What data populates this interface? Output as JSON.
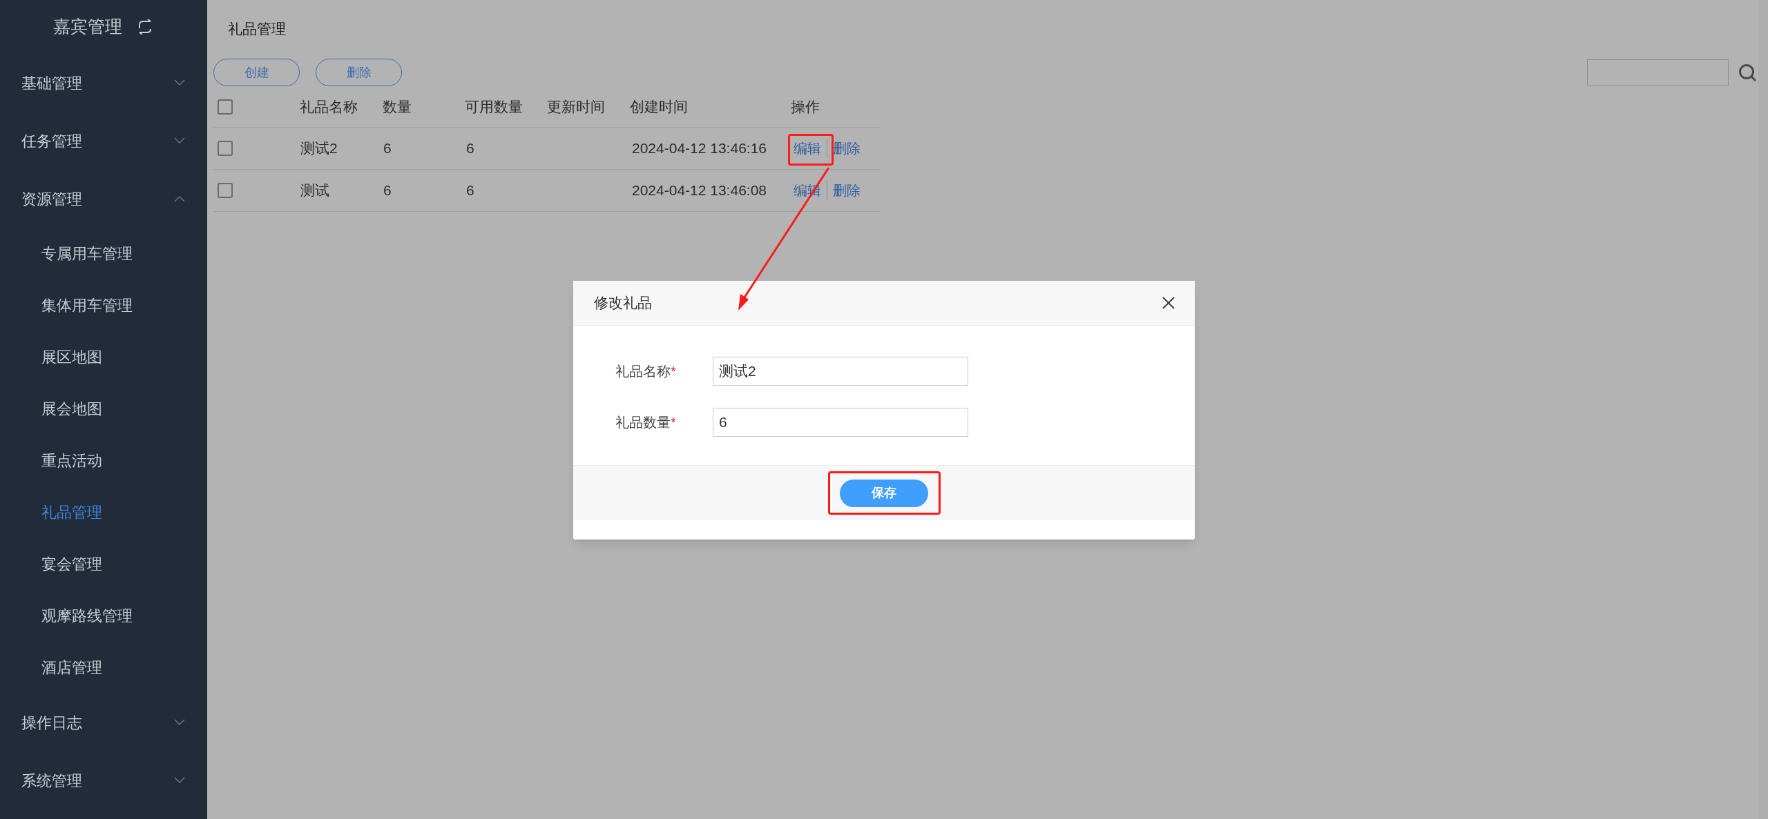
{
  "sidebar": {
    "title": "嘉宾管理",
    "items": [
      {
        "label": "基础管理",
        "expanded": false
      },
      {
        "label": "任务管理",
        "expanded": false
      },
      {
        "label": "资源管理",
        "expanded": true,
        "children": [
          {
            "label": "专属用车管理",
            "selected": false
          },
          {
            "label": "集体用车管理",
            "selected": false
          },
          {
            "label": "展区地图",
            "selected": false
          },
          {
            "label": "展会地图",
            "selected": false
          },
          {
            "label": "重点活动",
            "selected": false
          },
          {
            "label": "礼品管理",
            "selected": true
          },
          {
            "label": "宴会管理",
            "selected": false
          },
          {
            "label": "观摩路线管理",
            "selected": false
          },
          {
            "label": "酒店管理",
            "selected": false
          }
        ]
      },
      {
        "label": "操作日志",
        "expanded": false
      },
      {
        "label": "系统管理",
        "expanded": false
      }
    ]
  },
  "page": {
    "title": "礼品管理",
    "toolbar": [
      "创建",
      "删除"
    ],
    "table": {
      "header_checked": false,
      "columns": [
        "礼品名称",
        "数量",
        "可用数量",
        "更新时间",
        "创建时间",
        "操作"
      ],
      "rows": [
        {
          "checked": false,
          "cells": [
            "测试2",
            "6",
            "6",
            "",
            "2024-04-12 13:46:16"
          ],
          "actions": [
            "编辑",
            "删除"
          ]
        },
        {
          "checked": false,
          "cells": [
            "测试",
            "6",
            "6",
            "",
            "2024-04-12 13:46:08"
          ],
          "actions": [
            "编辑",
            "删除"
          ]
        }
      ]
    }
  },
  "dialog": {
    "title": "修改礼品",
    "fields": [
      {
        "label": "礼品名称",
        "required_mark": "*",
        "value": "测试2"
      },
      {
        "label": "礼品数量",
        "required_mark": "*",
        "value": "6"
      }
    ],
    "button": "保存"
  }
}
